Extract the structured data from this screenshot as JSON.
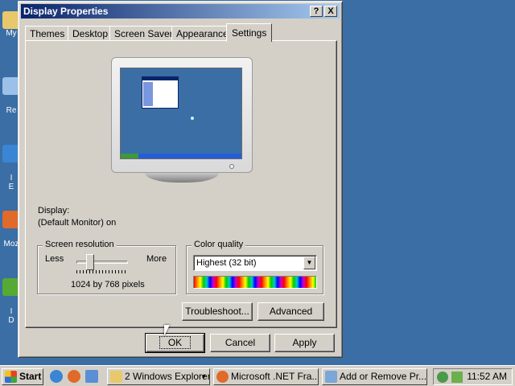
{
  "desktop": {
    "icons": [
      {
        "label": "My",
        "icon": "my-documents-icon",
        "color": "#e8c86a"
      },
      {
        "label": "Re",
        "icon": "recycle-bin-icon",
        "color": "#9cc0e8"
      },
      {
        "label": "I",
        "label2": "E",
        "icon": "internet-explorer-icon",
        "color": "#3a86d4"
      },
      {
        "label": "Moz",
        "icon": "mozilla-icon",
        "color": "#e06a2a"
      },
      {
        "label": "I",
        "label2": "D",
        "icon": "installer-icon",
        "color": "#55aa33"
      }
    ]
  },
  "dialog": {
    "title": "Display Properties",
    "help_button": "?",
    "close_button": "X",
    "tabs": [
      {
        "label": "Themes"
      },
      {
        "label": "Desktop"
      },
      {
        "label": "Screen Saver"
      },
      {
        "label": "Appearance"
      },
      {
        "label": "Settings",
        "active": true
      }
    ],
    "display_label": "Display:",
    "display_value": "(Default Monitor) on",
    "resolution": {
      "title": "Screen resolution",
      "less": "Less",
      "more": "More",
      "value_text": "1024 by 768 pixels",
      "slider_fraction": 0.2
    },
    "color_quality": {
      "title": "Color quality",
      "selected": "Highest (32 bit)"
    },
    "buttons": {
      "troubleshoot": "Troubleshoot...",
      "advanced": "Advanced",
      "ok": "OK",
      "cancel": "Cancel",
      "apply": "Apply"
    }
  },
  "taskbar": {
    "start": "Start",
    "items": [
      {
        "label": "2 Windows Explorer",
        "icon": "folder-icon",
        "has_dropdown": true
      },
      {
        "label": "Microsoft .NET Fra...",
        "icon": "firefox-icon"
      },
      {
        "label": "Add or Remove Pr...",
        "icon": "add-remove-programs-icon"
      }
    ],
    "clock": "11:52 AM"
  },
  "colors": {
    "desktop": "#3a6ea5",
    "title_gradient_start": "#0a246a",
    "title_gradient_end": "#a6caf0",
    "face": "#d4d0c8"
  }
}
